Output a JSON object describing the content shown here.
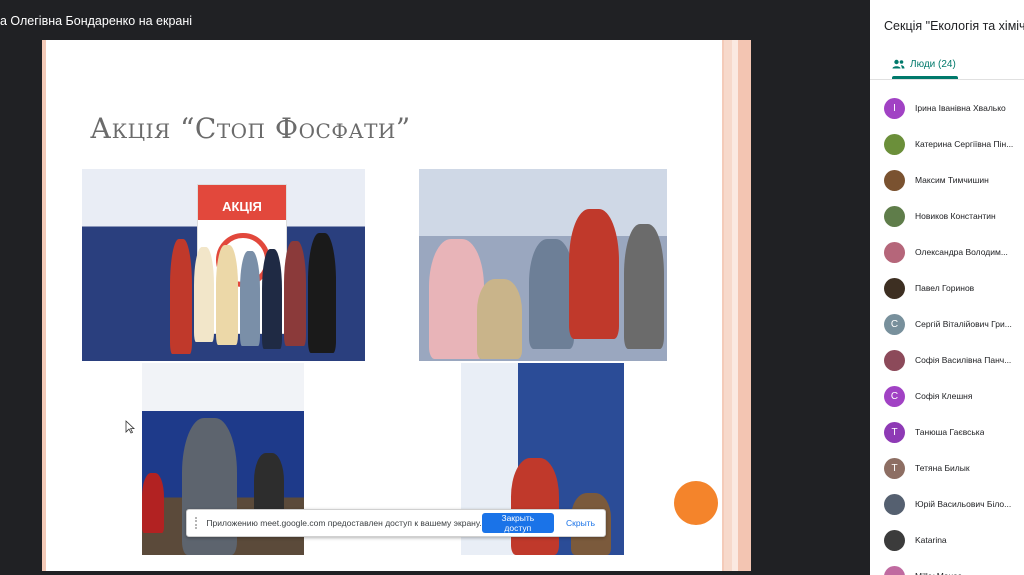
{
  "stage": {
    "presenter_title": "а Олегівна Бондаренко на екрані"
  },
  "slide": {
    "title": "Акція “Стоп Фосфати”",
    "banner_text": "АКЦІЯ"
  },
  "share_bar": {
    "message": "Приложению meet.google.com предоставлен доступ к вашему экрану.",
    "stop_label": "Закрыть доступ",
    "hide_label": "Скрыть"
  },
  "panel": {
    "title": "Секція \"Екологія та хімічні",
    "people_tab_label": "Люди (24)",
    "accent_color": "#00796b",
    "people": [
      {
        "name": "Ірина Іванівна Хвалько",
        "initial": "І",
        "color": "#a142c4"
      },
      {
        "name": "Катерина Сергіївна Пін...",
        "initial": "",
        "color": "#6b8f3a"
      },
      {
        "name": "Максим Тимчишин",
        "initial": "",
        "color": "#7a5230"
      },
      {
        "name": "Новиков Константин",
        "initial": "",
        "color": "#5f7d4a"
      },
      {
        "name": "Олександра Володим...",
        "initial": "",
        "color": "#b5667a"
      },
      {
        "name": "Павел Горинов",
        "initial": "",
        "color": "#3d2f22"
      },
      {
        "name": "Сергій Віталійович Гри...",
        "initial": "С",
        "color": "#78909c"
      },
      {
        "name": "Софія Василівна Панч...",
        "initial": "",
        "color": "#8c4a5a"
      },
      {
        "name": "Софія Клешня",
        "initial": "С",
        "color": "#a142c4"
      },
      {
        "name": "Танюша Гаєвська",
        "initial": "Т",
        "color": "#8e3ab5"
      },
      {
        "name": "Тетяна Билык",
        "initial": "Т",
        "color": "#8d6e63"
      },
      {
        "name": "Юрій Васильович Біло...",
        "initial": "",
        "color": "#556070"
      },
      {
        "name": "Katarina",
        "initial": "",
        "color": "#3b3b3b"
      },
      {
        "name": "Milky Mouse",
        "initial": "",
        "color": "#c06aa0"
      }
    ]
  }
}
